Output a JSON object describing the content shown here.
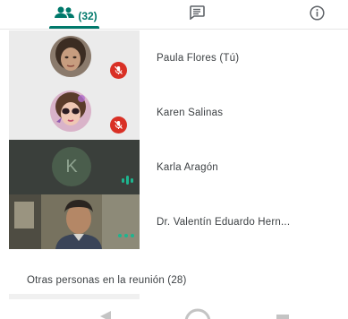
{
  "tabs": {
    "people_count": "(32)",
    "active_tab": "people",
    "accent_color": "#00796b"
  },
  "participants": [
    {
      "name": "Paula Flores (Tú)",
      "status": "muted",
      "avatar": "photo"
    },
    {
      "name": "Karen Salinas",
      "status": "muted",
      "avatar": "photo"
    },
    {
      "name": "Karla Aragón",
      "status": "speaking",
      "avatar": "initial",
      "initial": "K"
    },
    {
      "name": "Dr. Valentín Eduardo Hern...",
      "status": "video",
      "avatar": "video"
    }
  ],
  "others_section": {
    "title": "Otras personas en la reunión (28)"
  },
  "icons": {
    "people": "people-icon",
    "chat": "chat-icon",
    "info": "info-icon",
    "muted": "mic-off-icon",
    "speaking": "audio-level-icon",
    "more": "more-dots-icon"
  },
  "colors": {
    "mute_badge": "#d93025",
    "speaking": "#1db58f",
    "text": "#3c4043"
  }
}
